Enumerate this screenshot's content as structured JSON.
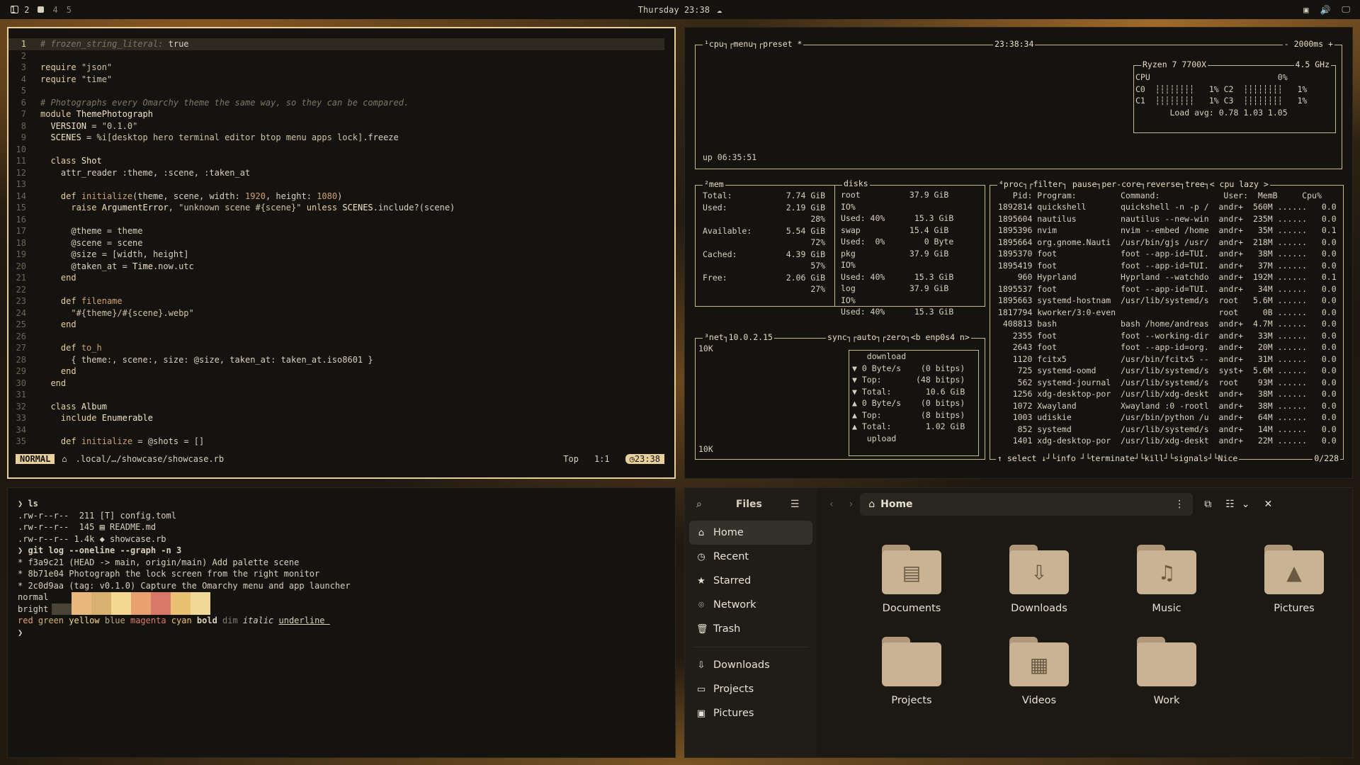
{
  "topbar": {
    "workspaces": [
      "1",
      "2",
      "4",
      "5"
    ],
    "clock": "Thursday 23:38"
  },
  "editor": {
    "lines": [
      {
        "n": "1",
        "html": "<span class='cm'># frozen_string_literal:</span> true"
      },
      {
        "n": "2",
        "html": ""
      },
      {
        "n": "3",
        "html": "<span class='kw'>require</span> <span class='st'>\"json\"</span>"
      },
      {
        "n": "4",
        "html": "<span class='kw'>require</span> <span class='st'>\"time\"</span>"
      },
      {
        "n": "5",
        "html": ""
      },
      {
        "n": "6",
        "html": "<span class='cm'># Photographs every Omarchy theme the same way, so they can be compared.</span>"
      },
      {
        "n": "7",
        "html": "<span class='kw'>module</span> <span class='cn'>ThemePhotograph</span>"
      },
      {
        "n": "8",
        "html": "  <span class='cn'>VERSION</span> = <span class='st'>\"0.1.0\"</span>"
      },
      {
        "n": "9",
        "html": "  <span class='cn'>SCENES</span> = <span class='st'>%i[desktop hero terminal editor btop menu apps lock]</span>.freeze"
      },
      {
        "n": "10",
        "html": ""
      },
      {
        "n": "11",
        "html": "  <span class='kw'>class</span> <span class='cn'>Shot</span>"
      },
      {
        "n": "12",
        "html": "    attr_reader :theme, :scene, :taken_at"
      },
      {
        "n": "13",
        "html": ""
      },
      {
        "n": "14",
        "html": "    <span class='kw'>def</span> <span class='nm'>initialize</span>(theme, scene, width: <span class='nm'>1920</span>, height: <span class='nm'>1080</span>)"
      },
      {
        "n": "15",
        "html": "      <span class='kw'>raise</span> <span class='cn'>ArgumentError</span>, <span class='st'>\"unknown scene #{scene}\"</span> <span class='kw'>unless</span> <span class='cn'>SCENES</span>.include?(scene)"
      },
      {
        "n": "16",
        "html": ""
      },
      {
        "n": "17",
        "html": "      @theme = theme"
      },
      {
        "n": "18",
        "html": "      @scene = scene"
      },
      {
        "n": "19",
        "html": "      @size = [width, height]"
      },
      {
        "n": "20",
        "html": "      @taken_at = <span class='cn'>Time</span>.now.utc"
      },
      {
        "n": "21",
        "html": "    <span class='kw'>end</span>"
      },
      {
        "n": "22",
        "html": ""
      },
      {
        "n": "23",
        "html": "    <span class='kw'>def</span> <span class='nm'>filename</span>"
      },
      {
        "n": "24",
        "html": "      <span class='st'>\"#{theme}/#{scene}.webp\"</span>"
      },
      {
        "n": "25",
        "html": "    <span class='kw'>end</span>"
      },
      {
        "n": "26",
        "html": ""
      },
      {
        "n": "27",
        "html": "    <span class='kw'>def</span> <span class='nm'>to_h</span>"
      },
      {
        "n": "28",
        "html": "      { theme:, scene:, size: @size, taken_at: taken_at.iso8601 }"
      },
      {
        "n": "29",
        "html": "    <span class='kw'>end</span>"
      },
      {
        "n": "30",
        "html": "  <span class='kw'>end</span>"
      },
      {
        "n": "31",
        "html": ""
      },
      {
        "n": "32",
        "html": "  <span class='kw'>class</span> <span class='cn'>Album</span>"
      },
      {
        "n": "33",
        "html": "    <span class='kw'>include</span> <span class='cn'>Enumerable</span>"
      },
      {
        "n": "34",
        "html": ""
      },
      {
        "n": "35",
        "html": "    <span class='kw'>def</span> <span class='nm'>initialize</span> = @shots = []"
      }
    ],
    "status": {
      "mode": "NORMAL",
      "file": ".local/…/showcase/showcase.rb",
      "pos": "Top",
      "cursor": "1:1",
      "time": "23:38"
    }
  },
  "terminal": {
    "lines": [
      "❯ ls",
      ".rw-r--r--  211 [T] config.toml",
      ".rw-r--r--  145 ▤ README.md",
      ".rw-r--r-- 1.4k ◆ showcase.rb",
      "❯ git log --oneline --graph -n 3",
      "* f3a9c21 (HEAD -> main, origin/main) Add palette scene",
      "* 8b71e04 Photograph the lock screen from the right monitor",
      "* 2c0d9aa (tag: v0.1.0) Capture the Omarchy menu and app launcher"
    ],
    "normal_label": "normal",
    "bright_label": "bright",
    "normal_colors": [
      "#15130f",
      "#e8b87c",
      "#d8b070",
      "#f4d890",
      "#e8a070",
      "#d87868",
      "#e8c070",
      "#f0d898"
    ],
    "bright_colors": [
      "#4a4438",
      "#e8b87c",
      "#d8b070",
      "#f4d890",
      "#e8a070",
      "#d87868",
      "#e8c070",
      "#f0d898"
    ],
    "styles_line": "red green yellow blue magenta cyan bold dim italic underline",
    "prompt": "❯"
  },
  "btop": {
    "cpu_label": "¹cpu┐┌menu┐┌preset *",
    "time": "23:38:34",
    "rate": "- 2000ms +",
    "cpu_name": "Ryzen 7 7700X",
    "cpu_ghz": "4.5 GHz",
    "cpu_rows": [
      "CPU                          0%",
      "C0  ┆┆┆┆┆┆┆┆   1% C2  ┆┆┆┆┆┆┆┆   1%",
      "C1  ┆┆┆┆┆┆┆┆   1% C3  ┆┆┆┆┆┆┆┆   1%",
      "       Load avg: 0.78 1.03 1.05"
    ],
    "uptime": "up 06:35:51",
    "mem_label": "²mem",
    "mem_rows": [
      "Total:           7.74 GiB",
      "Used:            2.19 GiB",
      "                      28%",
      "Available:       5.54 GiB",
      "                      72%",
      "Cached:          4.39 GiB",
      "                      57%",
      "Free:            2.06 GiB",
      "                      27%"
    ],
    "disks_label": "disks",
    "disk_rows": [
      "root          37.9 GiB",
      "IO%",
      "Used: 40%      15.3 GiB",
      "swap          15.4 GiB",
      "Used:  0%        0 Byte",
      "pkg           37.9 GiB",
      "IO%",
      "Used: 40%      15.3 GiB",
      "log           37.9 GiB",
      "IO%",
      "Used: 40%      15.3 GiB"
    ],
    "net_label": "³net┐10.0.2.15",
    "net_opts": "sync┐┌auto┐┌zero┐<b enp0s4 n>",
    "net_scale_top": "10K",
    "net_scale_bot": "10K",
    "net_rows": [
      "   download",
      "▼ 0 Byte/s    (0 bitps)",
      "▼ Top:       (48 bitps)",
      "▼ Total:       10.6 GiB",
      "",
      "▲ 0 Byte/s    (0 bitps)",
      "▲ Top:        (8 bitps)",
      "▲ Total:       1.02 GiB",
      "   upload"
    ],
    "proc_label": "⁴proc┐┌filter┐     pause┐per-core┐reverse┐tree┐< cpu lazy >",
    "proc_header": "    Pid: Program:         Command:             User:  MemB     Cpu%",
    "proc_rows": [
      [
        "1892814",
        "quickshell",
        "quickshell -n -p /",
        "andr+",
        "560M",
        "0.0"
      ],
      [
        "1895604",
        "nautilus",
        "nautilus --new-win",
        "andr+",
        "235M",
        "0.0"
      ],
      [
        "1895396",
        "nvim",
        "nvim --embed /home",
        "andr+",
        "35M",
        "0.1"
      ],
      [
        "1895664",
        "org.gnome.Nauti",
        "/usr/bin/gjs /usr/",
        "andr+",
        "218M",
        "0.0"
      ],
      [
        "1895370",
        "foot",
        "foot --app-id=TUI.",
        "andr+",
        "38M",
        "0.0"
      ],
      [
        "1895419",
        "foot",
        "foot --app-id=TUI.",
        "andr+",
        "37M",
        "0.0"
      ],
      [
        "960",
        "Hyprland",
        "Hyprland --watchdo",
        "andr+",
        "192M",
        "0.1"
      ],
      [
        "1895537",
        "foot",
        "foot --app-id=TUI.",
        "andr+",
        "34M",
        "0.0"
      ],
      [
        "1895663",
        "systemd-hostnam",
        "/usr/lib/systemd/s",
        "root",
        "5.6M",
        "0.0"
      ],
      [
        "1817794",
        "kworker/3:0-even",
        "",
        "root",
        "0B",
        "0.0"
      ],
      [
        "408813",
        "bash",
        "bash /home/andreas",
        "andr+",
        "4.7M",
        "0.0"
      ],
      [
        "2355",
        "foot",
        "foot --working-dir",
        "andr+",
        "33M",
        "0.0"
      ],
      [
        "2643",
        "foot",
        "foot --app-id=org.",
        "andr+",
        "20M",
        "0.0"
      ],
      [
        "1120",
        "fcitx5",
        "/usr/bin/fcitx5 --",
        "andr+",
        "31M",
        "0.0"
      ],
      [
        "725",
        "systemd-oomd",
        "/usr/lib/systemd/s",
        "syst+",
        "5.6M",
        "0.0"
      ],
      [
        "562",
        "systemd-journal",
        "/usr/lib/systemd/s",
        "root",
        "93M",
        "0.0"
      ],
      [
        "1256",
        "xdg-desktop-por",
        "/usr/lib/xdg-deskt",
        "andr+",
        "38M",
        "0.0"
      ],
      [
        "1072",
        "Xwayland",
        "Xwayland :0 -rootl",
        "andr+",
        "38M",
        "0.0"
      ],
      [
        "1003",
        "udiskie",
        "/usr/bin/python /u",
        "andr+",
        "64M",
        "0.0"
      ],
      [
        "852",
        "systemd",
        "/usr/lib/systemd/s",
        "andr+",
        "14M",
        "0.0"
      ],
      [
        "1401",
        "xdg-desktop-por",
        "/usr/lib/xdg-deskt",
        "andr+",
        "22M",
        "0.0"
      ]
    ],
    "proc_footer": "↑ select ↓┘└info ┘└terminate┘└kill┘└signals┘└Nice",
    "proc_count": "0/228"
  },
  "files": {
    "title": "Files",
    "path": "Home",
    "sidebar": [
      {
        "label": "Home",
        "icon": "⌂",
        "sel": true
      },
      {
        "label": "Recent",
        "icon": "◷"
      },
      {
        "label": "Starred",
        "icon": "★"
      },
      {
        "label": "Network",
        "icon": "⌾"
      },
      {
        "label": "Trash",
        "icon": "🗑"
      }
    ],
    "bookmarks": [
      {
        "label": "Downloads",
        "icon": "⇩"
      },
      {
        "label": "Projects",
        "icon": "▭"
      },
      {
        "label": "Pictures",
        "icon": "▣"
      }
    ],
    "folders": [
      {
        "label": "Documents",
        "glyph": "▤"
      },
      {
        "label": "Downloads",
        "glyph": "⇩"
      },
      {
        "label": "Music",
        "glyph": "♫"
      },
      {
        "label": "Pictures",
        "glyph": "▲"
      },
      {
        "label": "Projects",
        "glyph": ""
      },
      {
        "label": "Videos",
        "glyph": "▦"
      },
      {
        "label": "Work",
        "glyph": ""
      }
    ]
  }
}
